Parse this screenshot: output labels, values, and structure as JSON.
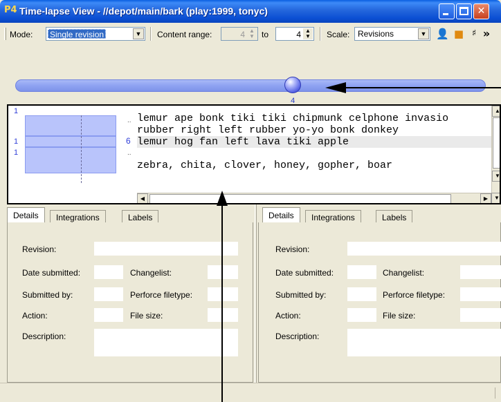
{
  "window": {
    "title": "Time-lapse View - //depot/main/bark (play:1999, tonyc)",
    "icon_text": "P4"
  },
  "toolbar": {
    "mode_label": "Mode:",
    "mode_value": "Single revision",
    "content_range_label": "Content range:",
    "range_from": "4",
    "to_label": "to",
    "range_to": "4",
    "scale_label": "Scale:",
    "scale_value": "Revisions",
    "overflow_label": "»"
  },
  "slider": {
    "value_label": "4",
    "position_fraction": 0.59
  },
  "content": {
    "gutter": {
      "markers": [
        "1",
        "1",
        "1"
      ],
      "line_number": "6",
      "dots_top": "..",
      "dots_bottom": ".."
    },
    "lines": [
      "lemur ape bonk tiki tiki chipmunk celphone invasio",
      "rubber right left rubber yo-yo bonk donkey",
      "lemur hog fan left lava tiki apple",
      "",
      "zebra, chita, clover, honey, gopher, boar"
    ]
  },
  "panels": {
    "tabs": [
      "Details",
      "Integrations",
      "Labels"
    ],
    "fields": {
      "revision": "Revision:",
      "date_submitted": "Date submitted:",
      "changelist": "Changelist:",
      "submitted_by": "Submitted by:",
      "filetype": "Perforce filetype:",
      "action": "Action:",
      "file_size": "File size:",
      "description": "Description:"
    }
  },
  "colors": {
    "titlebar": "#0b4fd3",
    "slider_track": "#8ea2f2",
    "gutter_block": "#b9c4fb",
    "accent_text": "#2f3ed8"
  }
}
